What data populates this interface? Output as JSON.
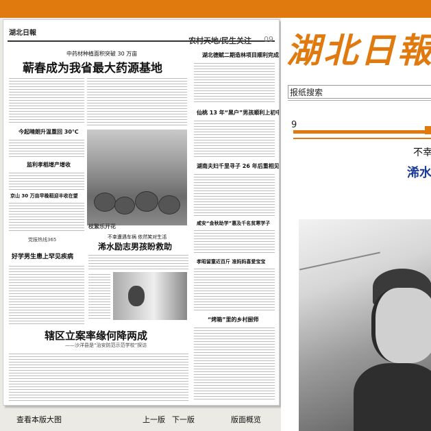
{
  "paper": {
    "masthead": "湖北日報",
    "page_name": "农村天地/民生关注",
    "page_number": "09",
    "articles": {
      "a1_kicker": "中药材种植面积突破 30 万亩",
      "a1_title": "蕲春成为我省最大药源基地",
      "a2_title": "今起晴朗升温重回 30℃",
      "a3_title": "监利孝稻增产增收",
      "a4_title": "京山 30 万亩早晚稻迎丰收在望",
      "a5_title": "好学男生患上罕见疾病",
      "a6_kicker": "不幸遭遇车祸 依然笑对生活",
      "a6_title": "浠水励志男孩盼救助",
      "a7_title": "辖区立案率缘何降两成",
      "a7_sub": "——沙洋县是“治安防范示范学校”探访",
      "r1_title": "湖北德赋二期造林项目顺利完成",
      "r2_title": "仙桃 13 年“黑户”男孩顺利上初中",
      "r3_title": "湖南夫妇千里寻子 26 年后重相见",
      "r4_title": "咸安“金秋助学”惠及千名贫寒学子",
      "r5_title": "孝昭留童近百斤 准妈妈喜爱宝宝",
      "r6_title": "“烤箱”里的乡村厨师",
      "photo_caption": "枝繁乐开花",
      "hotline": "党报热线365"
    }
  },
  "site": {
    "logo": "湖北日報",
    "search_label": "报纸搜索",
    "page_indicator": "9",
    "article_subtitle": "不幸",
    "article_title": "浠水"
  },
  "footer": {
    "view_large": "查看本版大图",
    "prev": "上一版",
    "next": "下一版",
    "overview": "版面概览"
  },
  "colors": {
    "brand_orange": "#e07a0e",
    "link_blue": "#1a3b99"
  }
}
